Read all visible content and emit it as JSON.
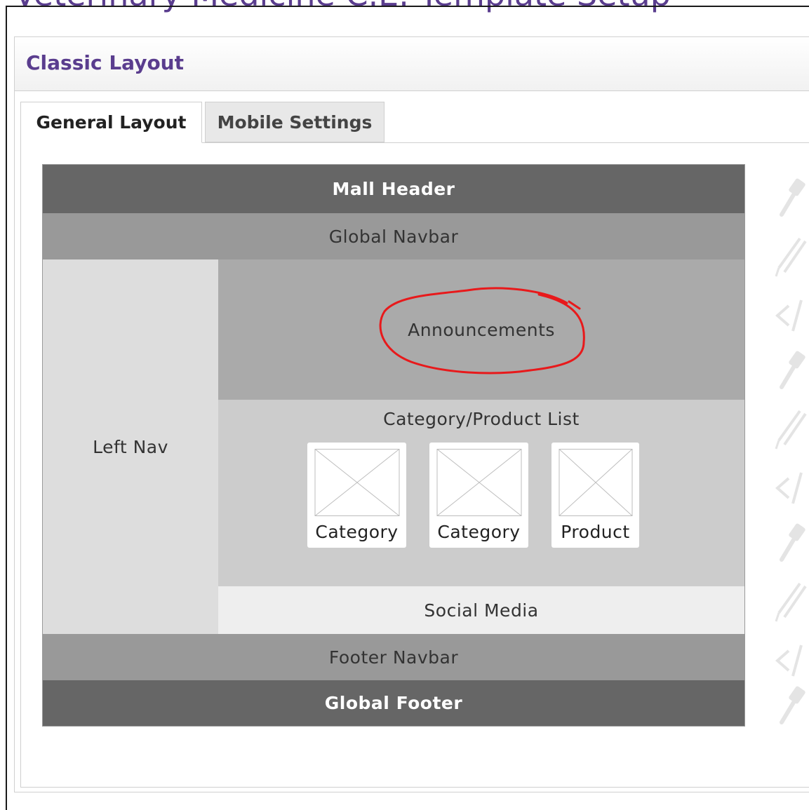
{
  "page": {
    "title": "Veterinary Medicine C.E. Template Setup"
  },
  "panel": {
    "title": "Classic Layout"
  },
  "tabs": [
    {
      "label": "General Layout",
      "active": true
    },
    {
      "label": "Mobile Settings",
      "active": false
    }
  ],
  "layout": {
    "mall_header": "Mall Header",
    "global_navbar": "Global Navbar",
    "left_nav": "Left Nav",
    "announcements": "Announcements",
    "category_product_list": "Category/Product List",
    "cards": [
      {
        "label": "Category",
        "icon": "image-placeholder-icon"
      },
      {
        "label": "Category",
        "icon": "image-placeholder-icon"
      },
      {
        "label": "Product",
        "icon": "image-placeholder-icon"
      }
    ],
    "social_media": "Social Media",
    "footer_navbar": "Footer Navbar",
    "global_footer": "Global Footer"
  },
  "annotation": {
    "color": "#e8191b",
    "target": "Announcements"
  },
  "side_icons": [
    "hammer-icon",
    "pencil-icon",
    "code-icon",
    "hammer-icon",
    "pencil-icon",
    "code-icon",
    "hammer-icon",
    "pencil-icon",
    "code-icon",
    "hammer-icon"
  ],
  "colors": {
    "accent": "#5a3d8e",
    "header_dark": "#666666",
    "nav_mid": "#999999"
  }
}
